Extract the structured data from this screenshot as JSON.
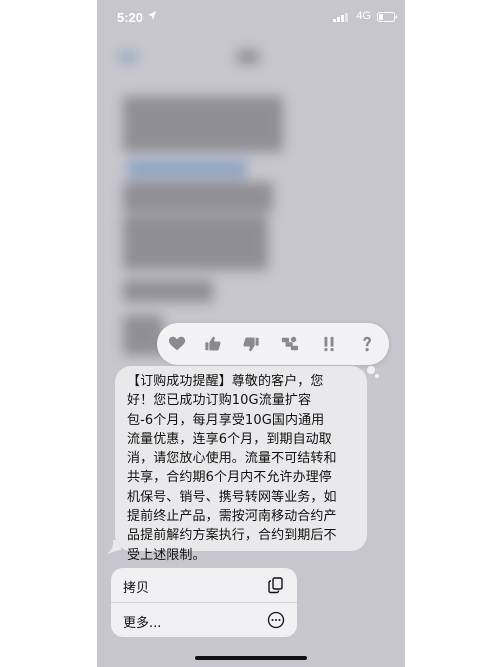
{
  "status_bar": {
    "time": "5:20",
    "network": "4G"
  },
  "reactions": [
    {
      "icon": "heart-icon"
    },
    {
      "icon": "thumbs-up-icon"
    },
    {
      "icon": "thumbs-down-icon"
    },
    {
      "icon": "haha-icon"
    },
    {
      "icon": "exclamation-icon"
    },
    {
      "icon": "question-icon"
    }
  ],
  "message": {
    "lines": [
      "【订购成功提醒】尊敬的客户，您",
      "好！您已成功订购10G流量扩容",
      "包-6个月，每月享受10G国内通用",
      "流量优惠，连享6个月，到期自动取",
      "消，请您放心使用。流量不可结转和",
      "共享，合约期6个月内不允许办理停",
      "机保号、销号、携号转网等业务，如",
      "提前终止产品，需按河南移动合约产",
      "品提前解约方案执行，合约到期后不",
      "受上述限制。"
    ]
  },
  "menu": {
    "copy_label": "拷贝",
    "copy_icon": "copy-icon",
    "more_label": "更多...",
    "more_icon": "more-circle-icon"
  },
  "colors": {
    "bubble": "#e9e9eb",
    "backdrop": "#c7c6cc",
    "menu": "#f0f0f2"
  }
}
